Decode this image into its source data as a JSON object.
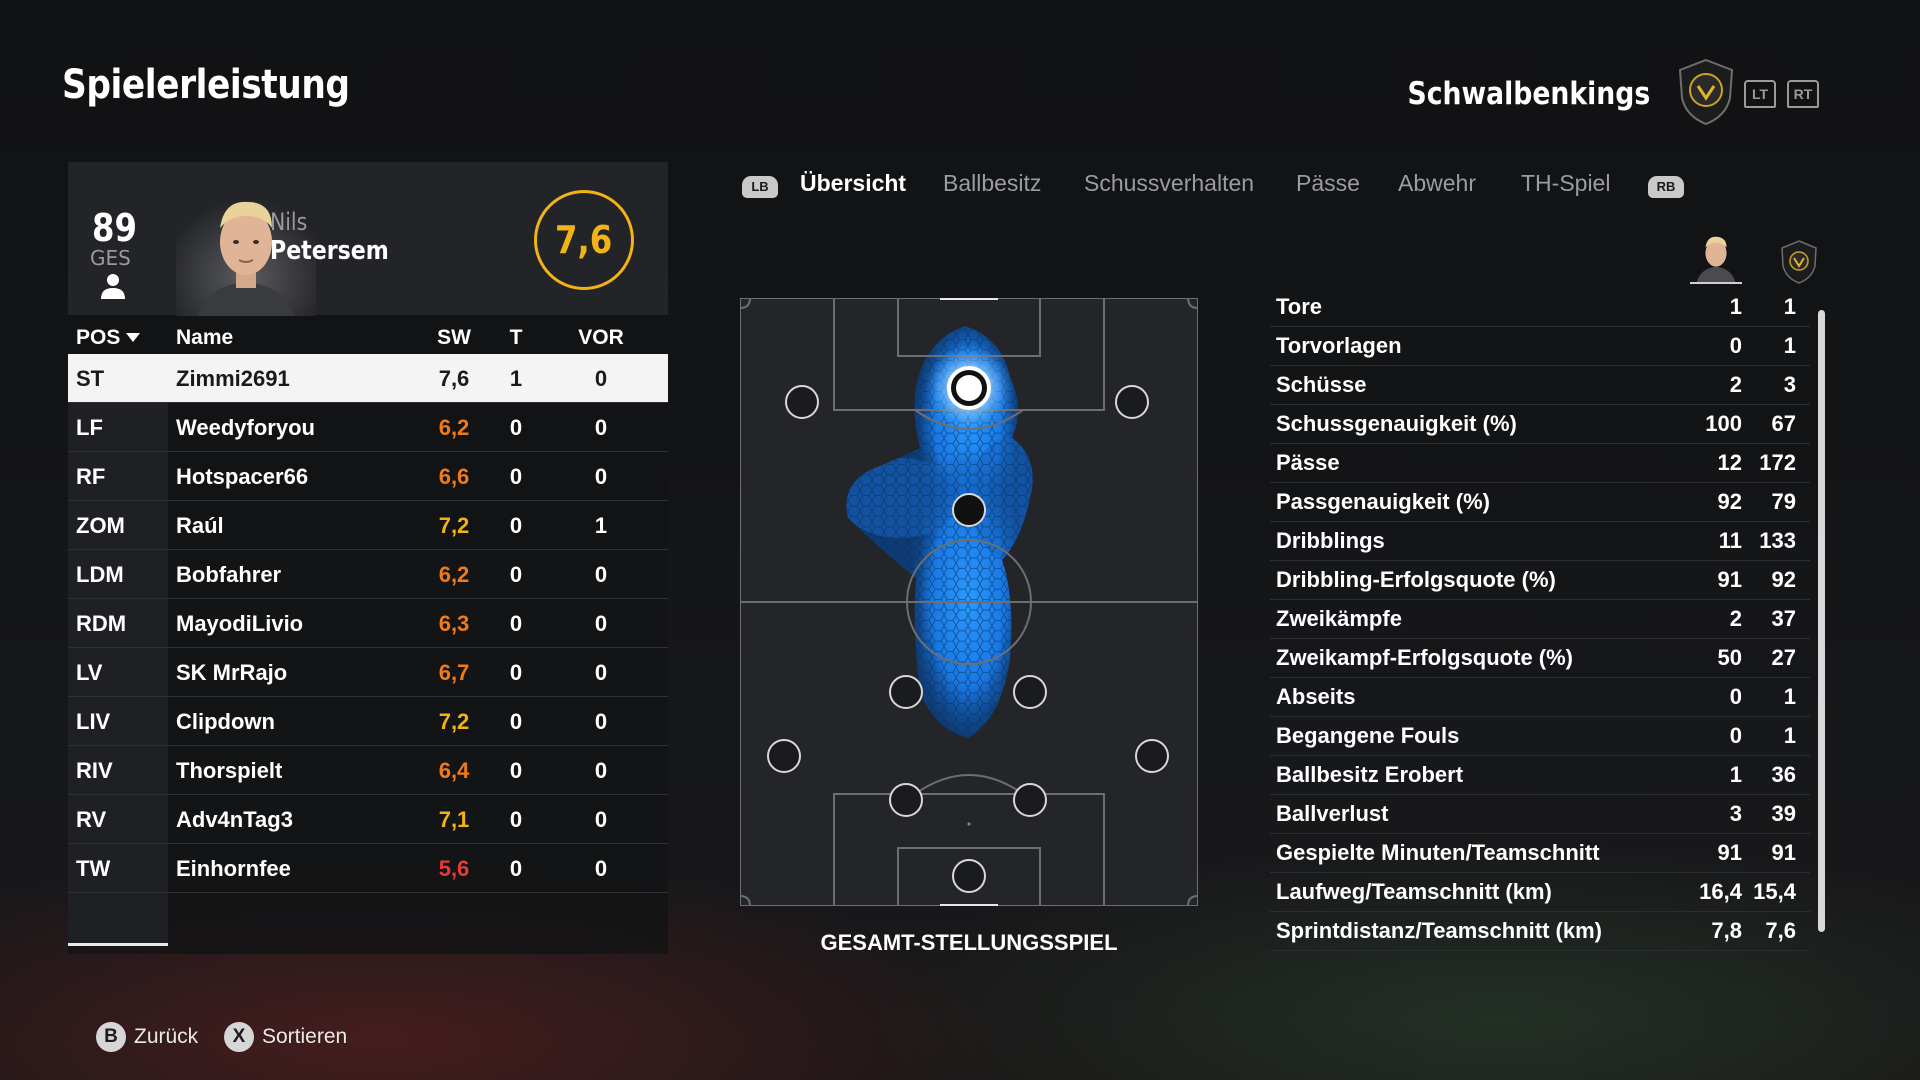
{
  "header": {
    "title": "Spielerleistung",
    "team_name": "Schwalbenkings",
    "lt_label": "LT",
    "rt_label": "RT"
  },
  "player_card": {
    "overall": "89",
    "overall_label": "GES",
    "first_name": "Nils",
    "last_name": "Petersem",
    "rating": "7,6"
  },
  "table": {
    "headers": {
      "pos": "POS",
      "name": "Name",
      "sw": "SW",
      "t": "T",
      "vor": "VOR"
    },
    "rows": [
      {
        "pos": "ST",
        "name": "Zimmi2691",
        "sw": "7,6",
        "t": "1",
        "vor": "0",
        "sw_color": "#1a1a1a"
      },
      {
        "pos": "LF",
        "name": "Weedyforyou",
        "sw": "6,2",
        "t": "0",
        "vor": "0",
        "sw_color": "#f07a1a"
      },
      {
        "pos": "RF",
        "name": "Hotspacer66",
        "sw": "6,6",
        "t": "0",
        "vor": "0",
        "sw_color": "#f07a1a"
      },
      {
        "pos": "ZOM",
        "name": "Raúl",
        "sw": "7,2",
        "t": "0",
        "vor": "1",
        "sw_color": "#f1b316"
      },
      {
        "pos": "LDM",
        "name": "Bobfahrer",
        "sw": "6,2",
        "t": "0",
        "vor": "0",
        "sw_color": "#f07a1a"
      },
      {
        "pos": "RDM",
        "name": "MayodiLivio",
        "sw": "6,3",
        "t": "0",
        "vor": "0",
        "sw_color": "#f07a1a"
      },
      {
        "pos": "LV",
        "name": "SK MrRajo",
        "sw": "6,7",
        "t": "0",
        "vor": "0",
        "sw_color": "#f07a1a"
      },
      {
        "pos": "LIV",
        "name": "Clipdown",
        "sw": "7,2",
        "t": "0",
        "vor": "0",
        "sw_color": "#f1b316"
      },
      {
        "pos": "RIV",
        "name": "Thorspielt",
        "sw": "6,4",
        "t": "0",
        "vor": "0",
        "sw_color": "#f07a1a"
      },
      {
        "pos": "RV",
        "name": "Adv4nTag3",
        "sw": "7,1",
        "t": "0",
        "vor": "0",
        "sw_color": "#f1b316"
      },
      {
        "pos": "TW",
        "name": "Einhornfee",
        "sw": "5,6",
        "t": "0",
        "vor": "0",
        "sw_color": "#e43b3b"
      }
    ]
  },
  "tabs": {
    "lb": "LB",
    "rb": "RB",
    "items": [
      "Übersicht",
      "Ballbesitz",
      "Schussverhalten",
      "Pässe",
      "Abwehr",
      "TH-Spiel"
    ]
  },
  "pitch": {
    "caption": "GESAMT-STELLUNGSSPIEL"
  },
  "stats": [
    {
      "label": "Tore",
      "player": "1",
      "team": "1"
    },
    {
      "label": "Torvorlagen",
      "player": "0",
      "team": "1"
    },
    {
      "label": "Schüsse",
      "player": "2",
      "team": "3"
    },
    {
      "label": "Schussgenauigkeit (%)",
      "player": "100",
      "team": "67"
    },
    {
      "label": "Pässe",
      "player": "12",
      "team": "172"
    },
    {
      "label": "Passgenauigkeit (%)",
      "player": "92",
      "team": "79"
    },
    {
      "label": "Dribblings",
      "player": "11",
      "team": "133"
    },
    {
      "label": "Dribbling-Erfolgsquote (%)",
      "player": "91",
      "team": "92"
    },
    {
      "label": "Zweikämpfe",
      "player": "2",
      "team": "37"
    },
    {
      "label": "Zweikampf-Erfolgsquote (%)",
      "player": "50",
      "team": "27"
    },
    {
      "label": "Abseits",
      "player": "0",
      "team": "1"
    },
    {
      "label": "Begangene Fouls",
      "player": "0",
      "team": "1"
    },
    {
      "label": "Ballbesitz Erobert",
      "player": "1",
      "team": "36"
    },
    {
      "label": "Ballverlust",
      "player": "3",
      "team": "39"
    },
    {
      "label": "Gespielte Minuten/Teamschnitt",
      "player": "91",
      "team": "91"
    },
    {
      "label": "Laufweg/Teamschnitt (km)",
      "player": "16,4",
      "team": "15,4"
    },
    {
      "label": "Sprintdistanz/Teamschnitt (km)",
      "player": "7,8",
      "team": "7,6"
    }
  ],
  "footer": {
    "back_key": "B",
    "back_label": "Zurück",
    "sort_key": "X",
    "sort_label": "Sortieren"
  },
  "colors": {
    "rating_gold": "#f1b316",
    "rating_orange": "#f07a1a",
    "rating_red": "#e43b3b",
    "heatmap_blue": "#1e8bff"
  },
  "icons": [
    "shield-crest-icon",
    "person-icon",
    "player-portrait",
    "team-crest-icon"
  ]
}
